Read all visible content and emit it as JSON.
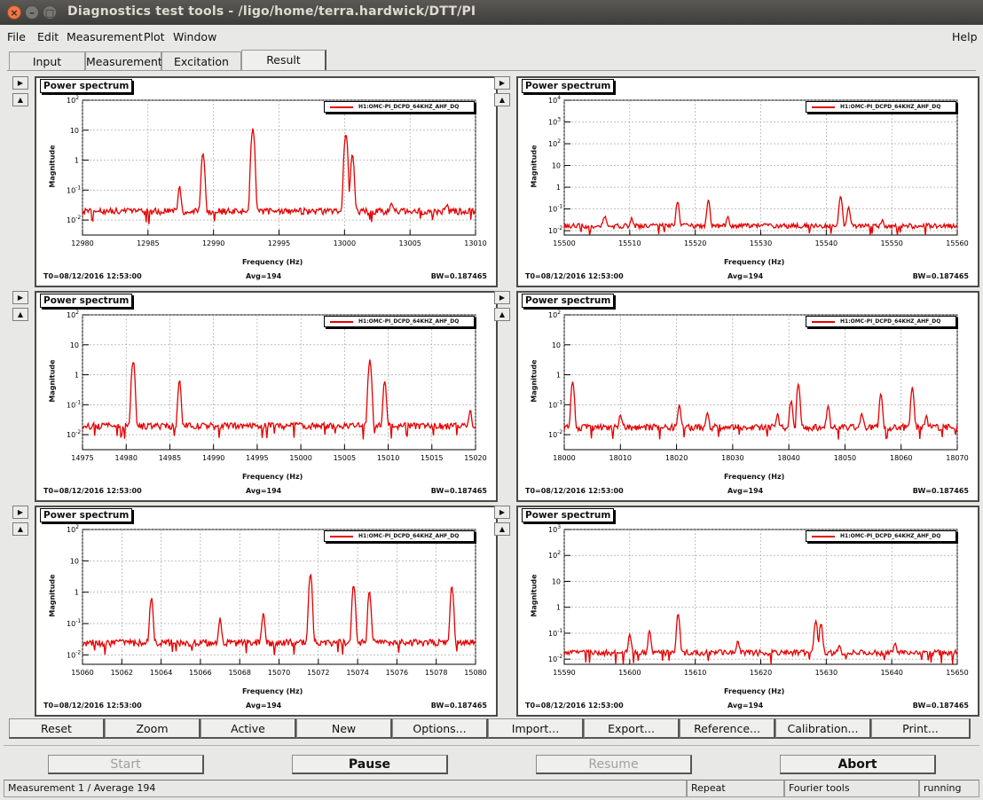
{
  "window": {
    "title": "Diagnostics test tools - /ligo/home/terra.hardwick/DTT/PI"
  },
  "menu": {
    "items": [
      "File",
      "Edit",
      "Measurement",
      "Plot",
      "Window"
    ],
    "help": "Help"
  },
  "tabs": [
    {
      "label": "Input",
      "active": false
    },
    {
      "label": "Measurement",
      "active": false
    },
    {
      "label": "Excitation",
      "active": false
    },
    {
      "label": "Result",
      "active": true
    }
  ],
  "plots": [
    {
      "title": "Power spectrum",
      "legend": "H1:OMC-PI_DCPD_64KHZ_AHF_DQ",
      "xlabel": "Frequency (Hz)",
      "ylabel": "Magnitude",
      "t0": "T0=08/12/2016 12:53:00",
      "avg": "Avg=194",
      "bw": "BW=0.187465",
      "chart_data": {
        "type": "line",
        "xlim": [
          12980,
          13010
        ],
        "xticks": [
          "12980",
          "12985",
          "12990",
          "12995",
          "13000",
          "13005",
          "13010"
        ],
        "ylog": true,
        "ylim_exp": [
          -2.5,
          2
        ],
        "yticks": [
          "10^-2",
          "10^-1",
          "1",
          "10",
          "10^2"
        ],
        "baseline": 0.02,
        "peaks": [
          [
            12987.4,
            0.13
          ],
          [
            12989.2,
            1.8
          ],
          [
            12993.0,
            12
          ],
          [
            13000.1,
            8
          ],
          [
            13000.6,
            1.5
          ],
          [
            13003.6,
            0.045
          ],
          [
            13007.8,
            0.03
          ]
        ],
        "color": "#e60000"
      }
    },
    {
      "title": "Power spectrum",
      "legend": "H1:OMC-PI_DCPD_64KHZ_AHF_DQ",
      "xlabel": "Frequency (Hz)",
      "ylabel": "Magnitude",
      "t0": "T0=08/12/2016 12:53:00",
      "avg": "Avg=194",
      "bw": "BW=0.187465",
      "chart_data": {
        "type": "line",
        "xlim": [
          15500,
          15560
        ],
        "xticks": [
          "15500",
          "15510",
          "15520",
          "15530",
          "15540",
          "15550",
          "15560"
        ],
        "ylog": true,
        "ylim_exp": [
          -2.2,
          4
        ],
        "yticks": [
          "10^-2",
          "10^-1",
          "1",
          "10",
          "10^2",
          "10^3",
          "10^4"
        ],
        "baseline": 0.017,
        "peaks": [
          [
            15506.2,
            0.05
          ],
          [
            15510.3,
            0.04
          ],
          [
            15517.3,
            0.22
          ],
          [
            15522.0,
            0.25
          ],
          [
            15525.0,
            0.045
          ],
          [
            15542.2,
            0.4
          ],
          [
            15543.4,
            0.12
          ],
          [
            15548.5,
            0.03
          ]
        ],
        "color": "#e60000"
      }
    },
    {
      "title": "Power spectrum",
      "legend": "H1:OMC-PI_DCPD_64KHZ_AHF_DQ",
      "xlabel": "Frequency (Hz)",
      "ylabel": "Magnitude",
      "t0": "T0=08/12/2016 12:53:00",
      "avg": "Avg=194",
      "bw": "BW=0.187465",
      "chart_data": {
        "type": "line",
        "xlim": [
          14975,
          15020
        ],
        "xticks": [
          "14975",
          "14980",
          "14985",
          "14990",
          "14995",
          "15000",
          "15005",
          "15010",
          "15015",
          "15020"
        ],
        "ylog": true,
        "ylim_exp": [
          -2.5,
          2
        ],
        "yticks": [
          "10^-2",
          "10^-1",
          "1",
          "10",
          "10^2"
        ],
        "baseline": 0.02,
        "peaks": [
          [
            14980.8,
            3
          ],
          [
            14986.1,
            0.6
          ],
          [
            15007.9,
            3
          ],
          [
            15009.6,
            0.6
          ],
          [
            15019.4,
            0.06
          ]
        ],
        "color": "#e60000"
      }
    },
    {
      "title": "Power spectrum",
      "legend": "H1:OMC-PI_DCPD_64KHZ_AHF_DQ",
      "xlabel": "Frequency (Hz)",
      "ylabel": "Magnitude",
      "t0": "T0=08/12/2016 12:53:00",
      "avg": "Avg=194",
      "bw": "BW=0.187465",
      "chart_data": {
        "type": "line",
        "xlim": [
          18000,
          18070
        ],
        "xticks": [
          "18000",
          "18010",
          "18020",
          "18030",
          "18040",
          "18050",
          "18060",
          "18070"
        ],
        "ylog": true,
        "ylim_exp": [
          -2.5,
          2
        ],
        "yticks": [
          "10^-2",
          "10^-1",
          "1",
          "10",
          "10^2"
        ],
        "baseline": 0.018,
        "peaks": [
          [
            18001.5,
            0.6
          ],
          [
            18010.0,
            0.05
          ],
          [
            18020.5,
            0.1
          ],
          [
            18025.5,
            0.06
          ],
          [
            18038.0,
            0.05
          ],
          [
            18040.4,
            0.15
          ],
          [
            18041.7,
            0.5
          ],
          [
            18047.0,
            0.1
          ],
          [
            18053.0,
            0.05
          ],
          [
            18056.4,
            0.25
          ],
          [
            18062.0,
            0.4
          ],
          [
            18064.5,
            0.04
          ]
        ],
        "color": "#e60000"
      }
    },
    {
      "title": "Power spectrum",
      "legend": "H1:OMC-PI_DCPD_64KHZ_AHF_DQ",
      "xlabel": "Frequency (Hz)",
      "ylabel": "Magnitude",
      "t0": "T0=08/12/2016 12:53:00",
      "avg": "Avg=194",
      "bw": "BW=0.187465",
      "chart_data": {
        "type": "line",
        "xlim": [
          15060,
          15080
        ],
        "xticks": [
          "15060",
          "15062",
          "15064",
          "15066",
          "15068",
          "15070",
          "15072",
          "15074",
          "15076",
          "15078",
          "15080"
        ],
        "ylog": true,
        "ylim_exp": [
          -2.3,
          2
        ],
        "yticks": [
          "10^-2",
          "10^-1",
          "1",
          "10",
          "10^2"
        ],
        "baseline": 0.025,
        "peaks": [
          [
            15063.5,
            0.65
          ],
          [
            15067.0,
            0.15
          ],
          [
            15069.2,
            0.22
          ],
          [
            15071.6,
            3.5
          ],
          [
            15073.8,
            1.7
          ],
          [
            15074.6,
            1.0
          ],
          [
            15078.8,
            1.6
          ]
        ],
        "color": "#e60000"
      }
    },
    {
      "title": "Power spectrum",
      "legend": "H1:OMC-PI_DCPD_64KHZ_AHF_DQ",
      "xlabel": "Frequency (Hz)",
      "ylabel": "Magnitude",
      "t0": "T0=08/12/2016 12:53:00",
      "avg": "Avg=194",
      "bw": "BW=0.187465",
      "chart_data": {
        "type": "line",
        "xlim": [
          15590,
          15650
        ],
        "xticks": [
          "15590",
          "15600",
          "15610",
          "15620",
          "15630",
          "15640",
          "15650"
        ],
        "ylog": true,
        "ylim_exp": [
          -2.2,
          3
        ],
        "yticks": [
          "10^-2",
          "10^-1",
          "1",
          "10",
          "10^2",
          "10^3"
        ],
        "baseline": 0.018,
        "peaks": [
          [
            15600.0,
            0.09
          ],
          [
            15603.0,
            0.12
          ],
          [
            15607.4,
            0.55
          ],
          [
            15616.5,
            0.05
          ],
          [
            15628.4,
            0.35
          ],
          [
            15629.2,
            0.25
          ],
          [
            15632.0,
            0.04
          ],
          [
            15640.5,
            0.04
          ]
        ],
        "color": "#e60000"
      }
    }
  ],
  "toolbar": [
    "Reset",
    "Zoom",
    "Active",
    "New",
    "Options...",
    "Import...",
    "Export...",
    "Reference...",
    "Calibration...",
    "Print..."
  ],
  "controls": {
    "start": "Start",
    "pause": "Pause",
    "resume": "Resume",
    "abort": "Abort"
  },
  "status": {
    "measurement": "Measurement 1 / Average 194",
    "repeat": "Repeat",
    "tools": "Fourier tools",
    "state": "running"
  }
}
